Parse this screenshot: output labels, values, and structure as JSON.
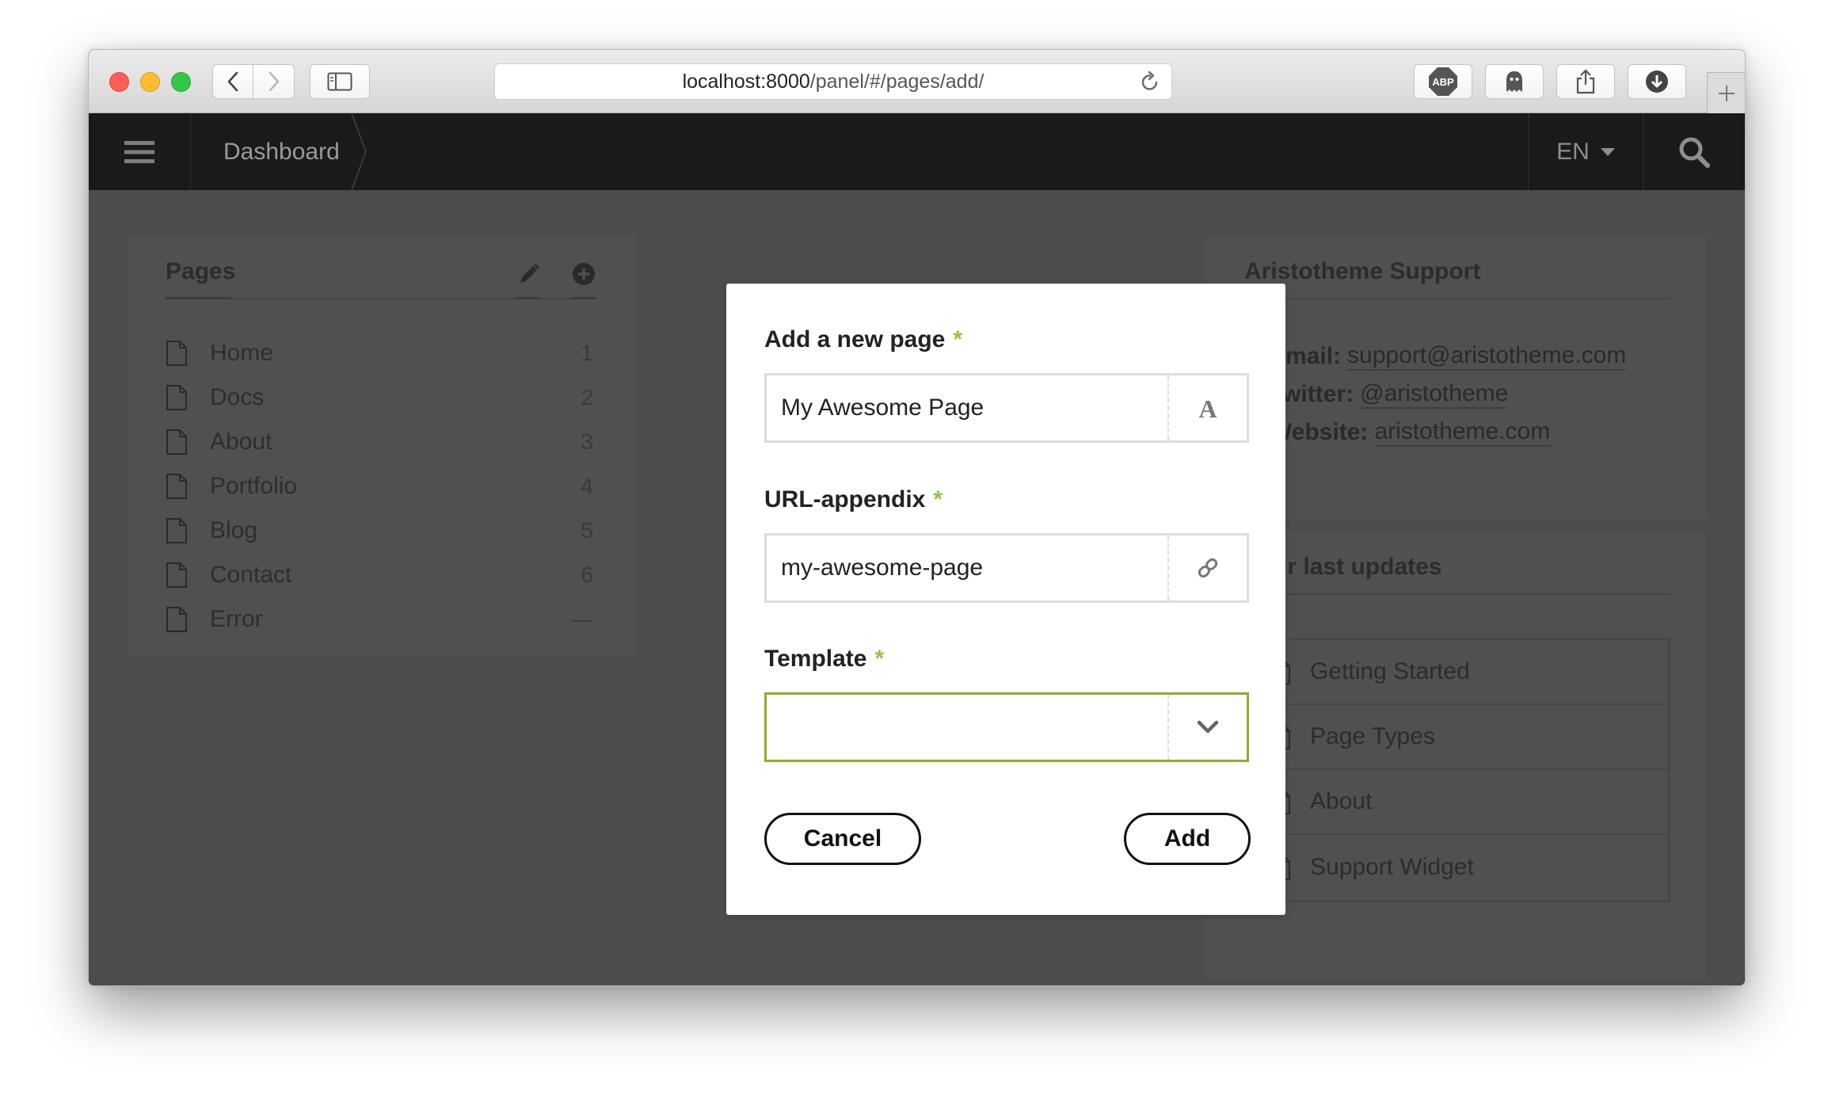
{
  "browser": {
    "url_host": "localhost:8000",
    "url_path": "/panel/#/pages/add/",
    "extensions": [
      "adblock-plus-icon",
      "ghostery-icon",
      "share-icon",
      "download-icon"
    ]
  },
  "nav": {
    "breadcrumb": "Dashboard",
    "language": "EN"
  },
  "pages_panel": {
    "title": "Pages",
    "items": [
      {
        "label": "Home",
        "num": "1"
      },
      {
        "label": "Docs",
        "num": "2"
      },
      {
        "label": "About",
        "num": "3"
      },
      {
        "label": "Portfolio",
        "num": "4"
      },
      {
        "label": "Blog",
        "num": "5"
      },
      {
        "label": "Contact",
        "num": "6"
      },
      {
        "label": "Error",
        "num": "—"
      }
    ]
  },
  "support_panel": {
    "title": "Aristotheme Support",
    "items": [
      {
        "key": "Email:",
        "value": "support@aristotheme.com"
      },
      {
        "key": "Twitter:",
        "value": "@aristotheme"
      },
      {
        "key": "Website:",
        "value": "aristotheme.com"
      }
    ]
  },
  "updates_panel": {
    "title": "Your last updates",
    "items": [
      "Getting Started",
      "Page Types",
      "About",
      "Support Widget"
    ]
  },
  "modal": {
    "title_label": "Add a new page",
    "title_value": "My Awesome Page",
    "url_label": "URL-appendix",
    "url_value": "my-awesome-page",
    "template_label": "Template",
    "template_value": "",
    "required_mark": "*",
    "cancel_label": "Cancel",
    "add_label": "Add"
  },
  "colors": {
    "accent": "#8dc63f",
    "active_border": "#8dae2b",
    "topbar": "#1a1a1a",
    "overlay": "#4c4c4c"
  }
}
